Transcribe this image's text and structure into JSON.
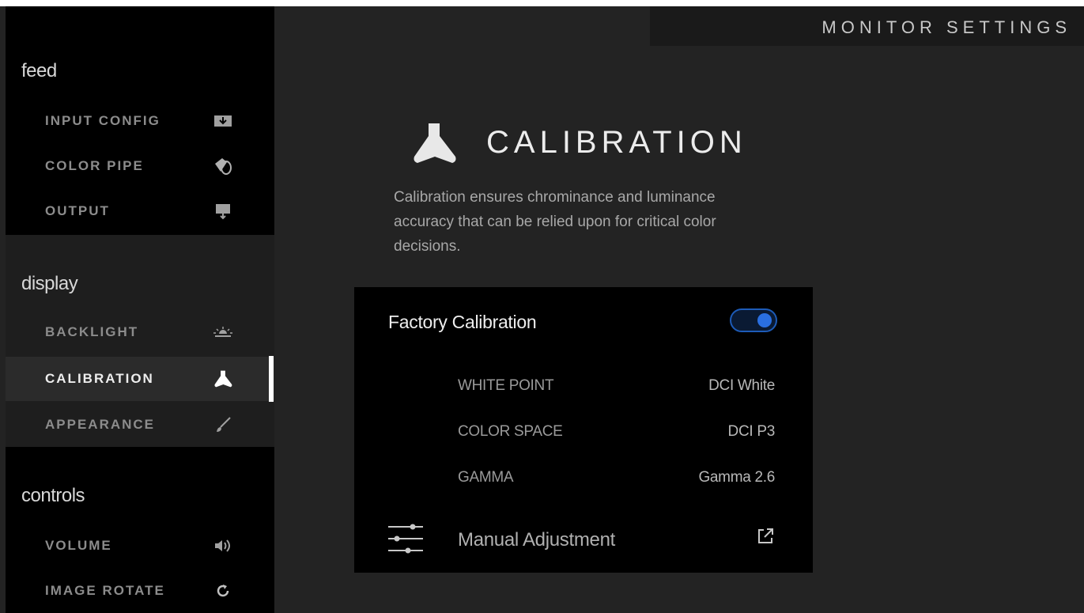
{
  "header": {
    "title": "MONITOR SETTINGS"
  },
  "sidebar": {
    "sections": [
      {
        "title": "feed",
        "items": [
          {
            "label": "INPUT CONFIG",
            "icon": "input-config-icon"
          },
          {
            "label": "COLOR PIPE",
            "icon": "color-pipe-icon"
          },
          {
            "label": "OUTPUT",
            "icon": "output-icon"
          }
        ]
      },
      {
        "title": "display",
        "items": [
          {
            "label": "BACKLIGHT",
            "icon": "backlight-icon"
          },
          {
            "label": "CALIBRATION",
            "icon": "calibration-icon",
            "active": true
          },
          {
            "label": "APPEARANCE",
            "icon": "appearance-icon"
          }
        ]
      },
      {
        "title": "controls",
        "items": [
          {
            "label": "VOLUME",
            "icon": "volume-icon"
          },
          {
            "label": "IMAGE ROTATE",
            "icon": "rotate-icon"
          }
        ]
      }
    ]
  },
  "main": {
    "title": "CALIBRATION",
    "description": "Calibration ensures chrominance and luminance accuracy that can be relied upon for critical color decisions.",
    "panel": {
      "heading": "Factory Calibration",
      "toggle_on": true,
      "rows": [
        {
          "label": "WHITE POINT",
          "value": "DCI White"
        },
        {
          "label": "COLOR SPACE",
          "value": "DCI P3"
        },
        {
          "label": "GAMMA",
          "value": "Gamma 2.6"
        }
      ],
      "manual_label": "Manual Adjustment"
    }
  },
  "colors": {
    "accent": "#2a6fe0",
    "background": "#232323",
    "panel": "#000000"
  }
}
